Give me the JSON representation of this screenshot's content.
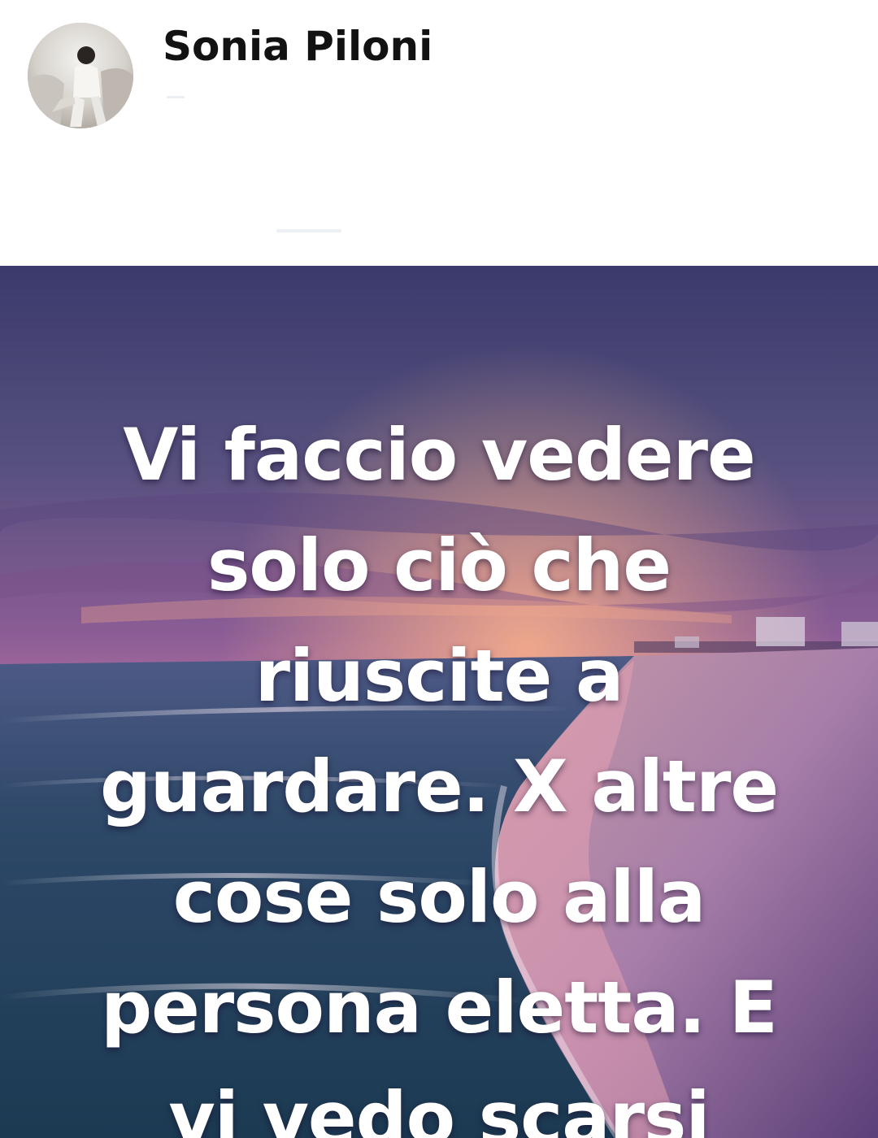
{
  "post": {
    "author": {
      "name": "Sonia Piloni",
      "avatar_icon": "profile-photo-icon"
    },
    "image": {
      "quote_lines": [
        "Vi faccio vedere",
        "solo ciò che",
        "riuscite a",
        "guardare. X altre",
        "cose solo alla",
        "persona eletta. E",
        "vi vedo scarsi"
      ],
      "colors": {
        "sky_top": "#3f3f73",
        "sky_mid": "#8a5b94",
        "horizon_glow": "#f29a88",
        "sea_dark": "#1f3e58",
        "sand": "#b98fb3",
        "text": "#ffffff"
      }
    }
  }
}
